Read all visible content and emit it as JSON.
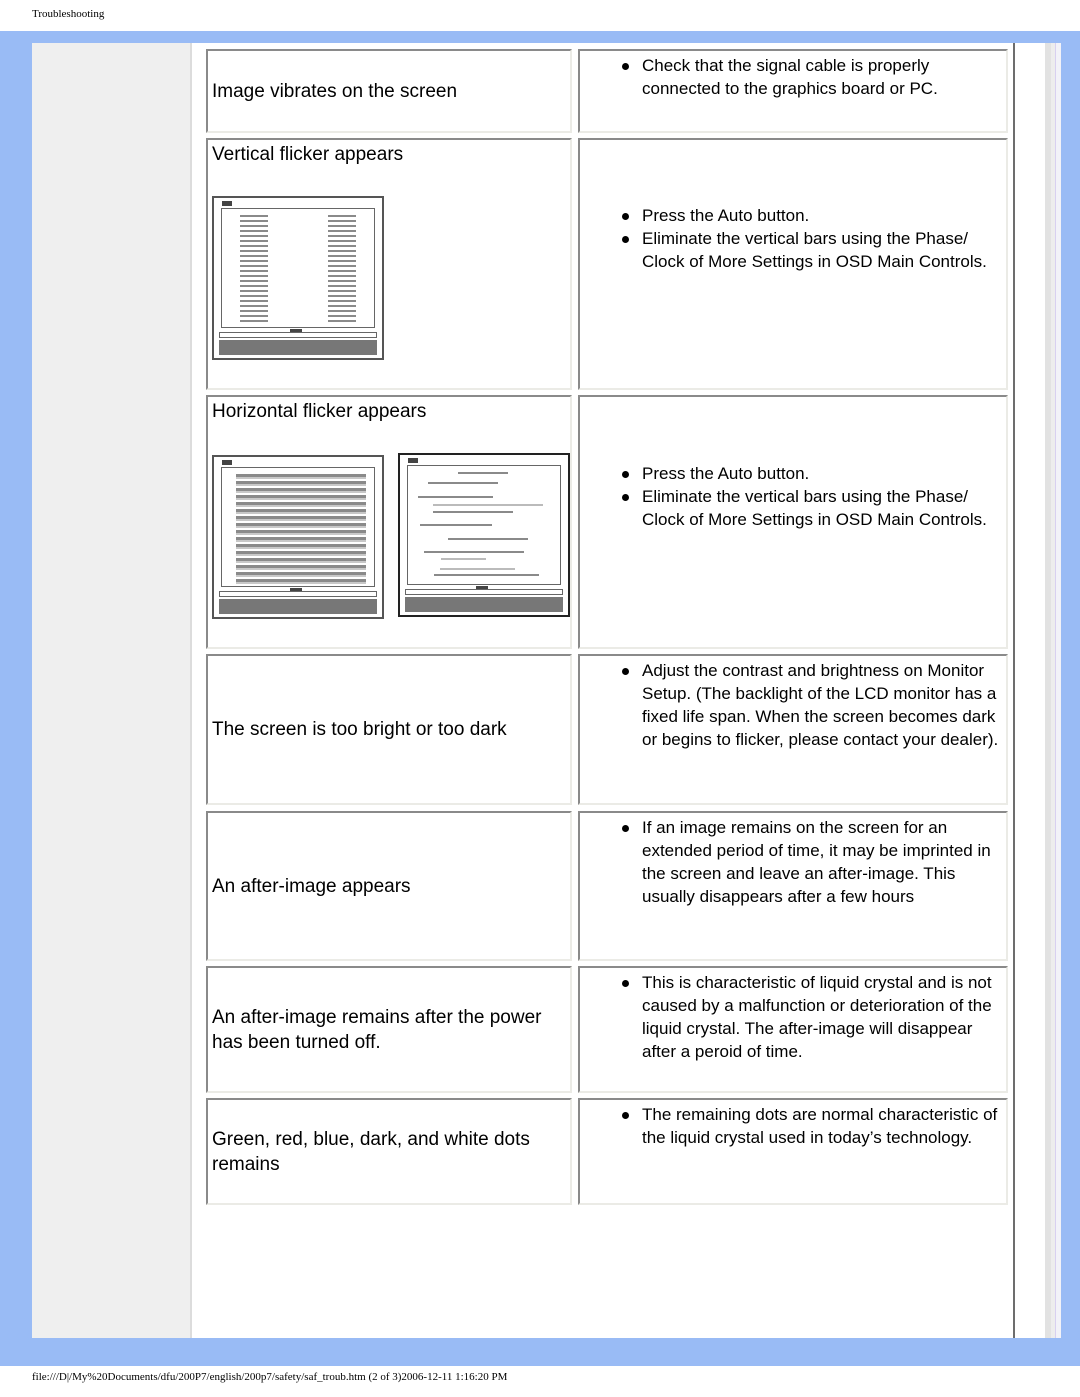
{
  "page": {
    "header_title": "Troubleshooting",
    "footer_path": "file:///D|/My%20Documents/dfu/200P7/english/200p7/safety/saf_troub.htm (2 of 3)2006-12-11 1:16:20 PM"
  },
  "colors": {
    "frame_blue": "#99bbf5",
    "sidebar_grey": "#efefef"
  },
  "rows": [
    {
      "problem": "Image vibrates on the screen",
      "solutions": [
        "Check that the signal cable is properly connected to the graphics board or PC."
      ]
    },
    {
      "problem": "Vertical flicker appears",
      "illustration": "monitor-vertical-flicker",
      "solutions": [
        "Press the Auto button.",
        "Eliminate the vertical bars using the Phase/ Clock of More Settings in OSD Main Controls."
      ]
    },
    {
      "problem": "Horizontal flicker appears",
      "illustration": [
        "monitor-horizontal-flicker-before",
        "monitor-horizontal-flicker-after"
      ],
      "solutions": [
        "Press the Auto button.",
        "Eliminate the vertical bars using the Phase/ Clock of More Settings in OSD Main Controls."
      ]
    },
    {
      "problem": "The screen is too bright or too dark",
      "solutions": [
        "Adjust the contrast and brightness on Monitor Setup. (The backlight of the LCD monitor has a fixed life span. When the screen becomes dark or begins to flicker, please contact your dealer)."
      ]
    },
    {
      "problem": "An after-image appears",
      "solutions": [
        "If an image remains on the screen for an extended period of time, it may be imprinted in the screen and leave an after-image. This usually disappears after a few hours"
      ]
    },
    {
      "problem": "An after-image remains after the power has been turned off.",
      "solutions": [
        "This is characteristic of liquid crystal and is not caused by a malfunction or deterioration of the liquid crystal. The after-image will disappear after a peroid of time."
      ]
    },
    {
      "problem": "Green, red, blue, dark, and white dots remains",
      "solutions": [
        "The remaining dots are normal characteristic of the liquid crystal used in today’s technology."
      ]
    }
  ]
}
